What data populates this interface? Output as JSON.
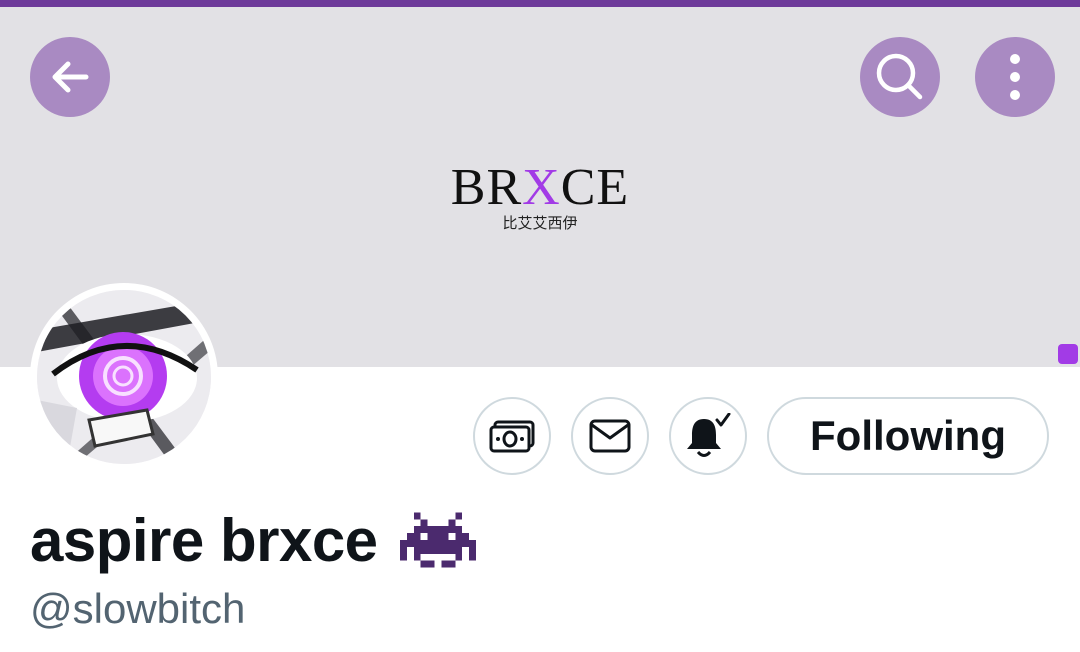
{
  "banner": {
    "brand_prefix": "BR",
    "brand_accent": "X",
    "brand_suffix": "CE",
    "brand_subtitle": "比艾艾西伊",
    "background": "#e2e1e5",
    "accent_color": "#a23be6"
  },
  "header": {
    "accent_bar_color": "#6e3a9a",
    "back_icon": "arrow-left-icon",
    "search_icon": "search-icon",
    "more_icon": "more-vertical-icon",
    "button_color": "#a98ac2"
  },
  "profile": {
    "display_name": "aspire brxce",
    "name_emoji": "space-invader-emoji",
    "handle": "@slowbitch",
    "avatar": "avatar-purple-eye"
  },
  "actions": {
    "tip_icon": "money-icon",
    "message_icon": "envelope-icon",
    "notify_icon": "bell-check-icon",
    "following_label": "Following"
  }
}
